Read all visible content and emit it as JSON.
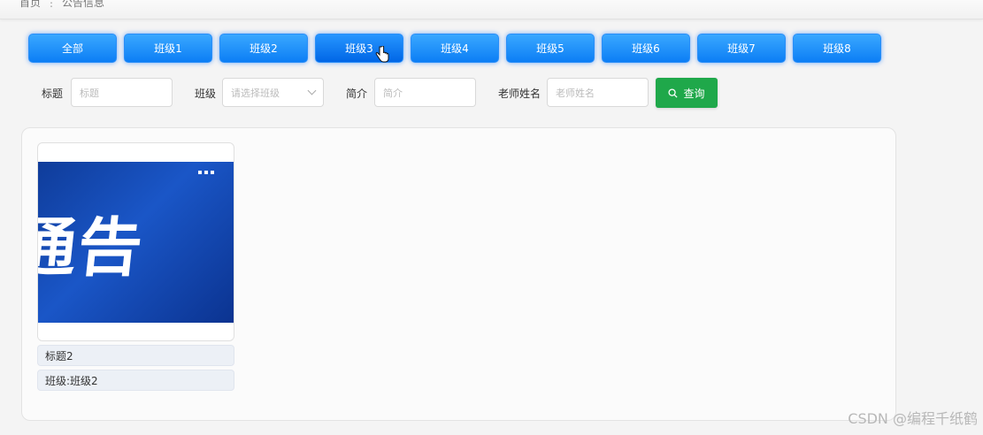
{
  "breadcrumb": {
    "home": "首页",
    "separator": "⋮",
    "current": "公告信息"
  },
  "tabs": [
    {
      "label": "全部"
    },
    {
      "label": "班级1"
    },
    {
      "label": "班级2"
    },
    {
      "label": "班级3",
      "active": true
    },
    {
      "label": "班级4"
    },
    {
      "label": "班级5"
    },
    {
      "label": "班级6"
    },
    {
      "label": "班级7"
    },
    {
      "label": "班级8"
    }
  ],
  "filters": {
    "title_label": "标题",
    "title_placeholder": "标题",
    "class_label": "班级",
    "class_placeholder": "请选择班级",
    "intro_label": "简介",
    "intro_placeholder": "简介",
    "teacher_label": "老师姓名",
    "teacher_placeholder": "老师姓名",
    "query_label": "查询"
  },
  "cards": [
    {
      "banner_text": "通告",
      "title": "标题2",
      "class_line": "班级:班级2"
    }
  ],
  "watermark": "CSDN @编程千纸鹤",
  "colors": {
    "tab": "#0c7ef5",
    "query": "#1fa84a",
    "banner": "#1a56c7"
  }
}
